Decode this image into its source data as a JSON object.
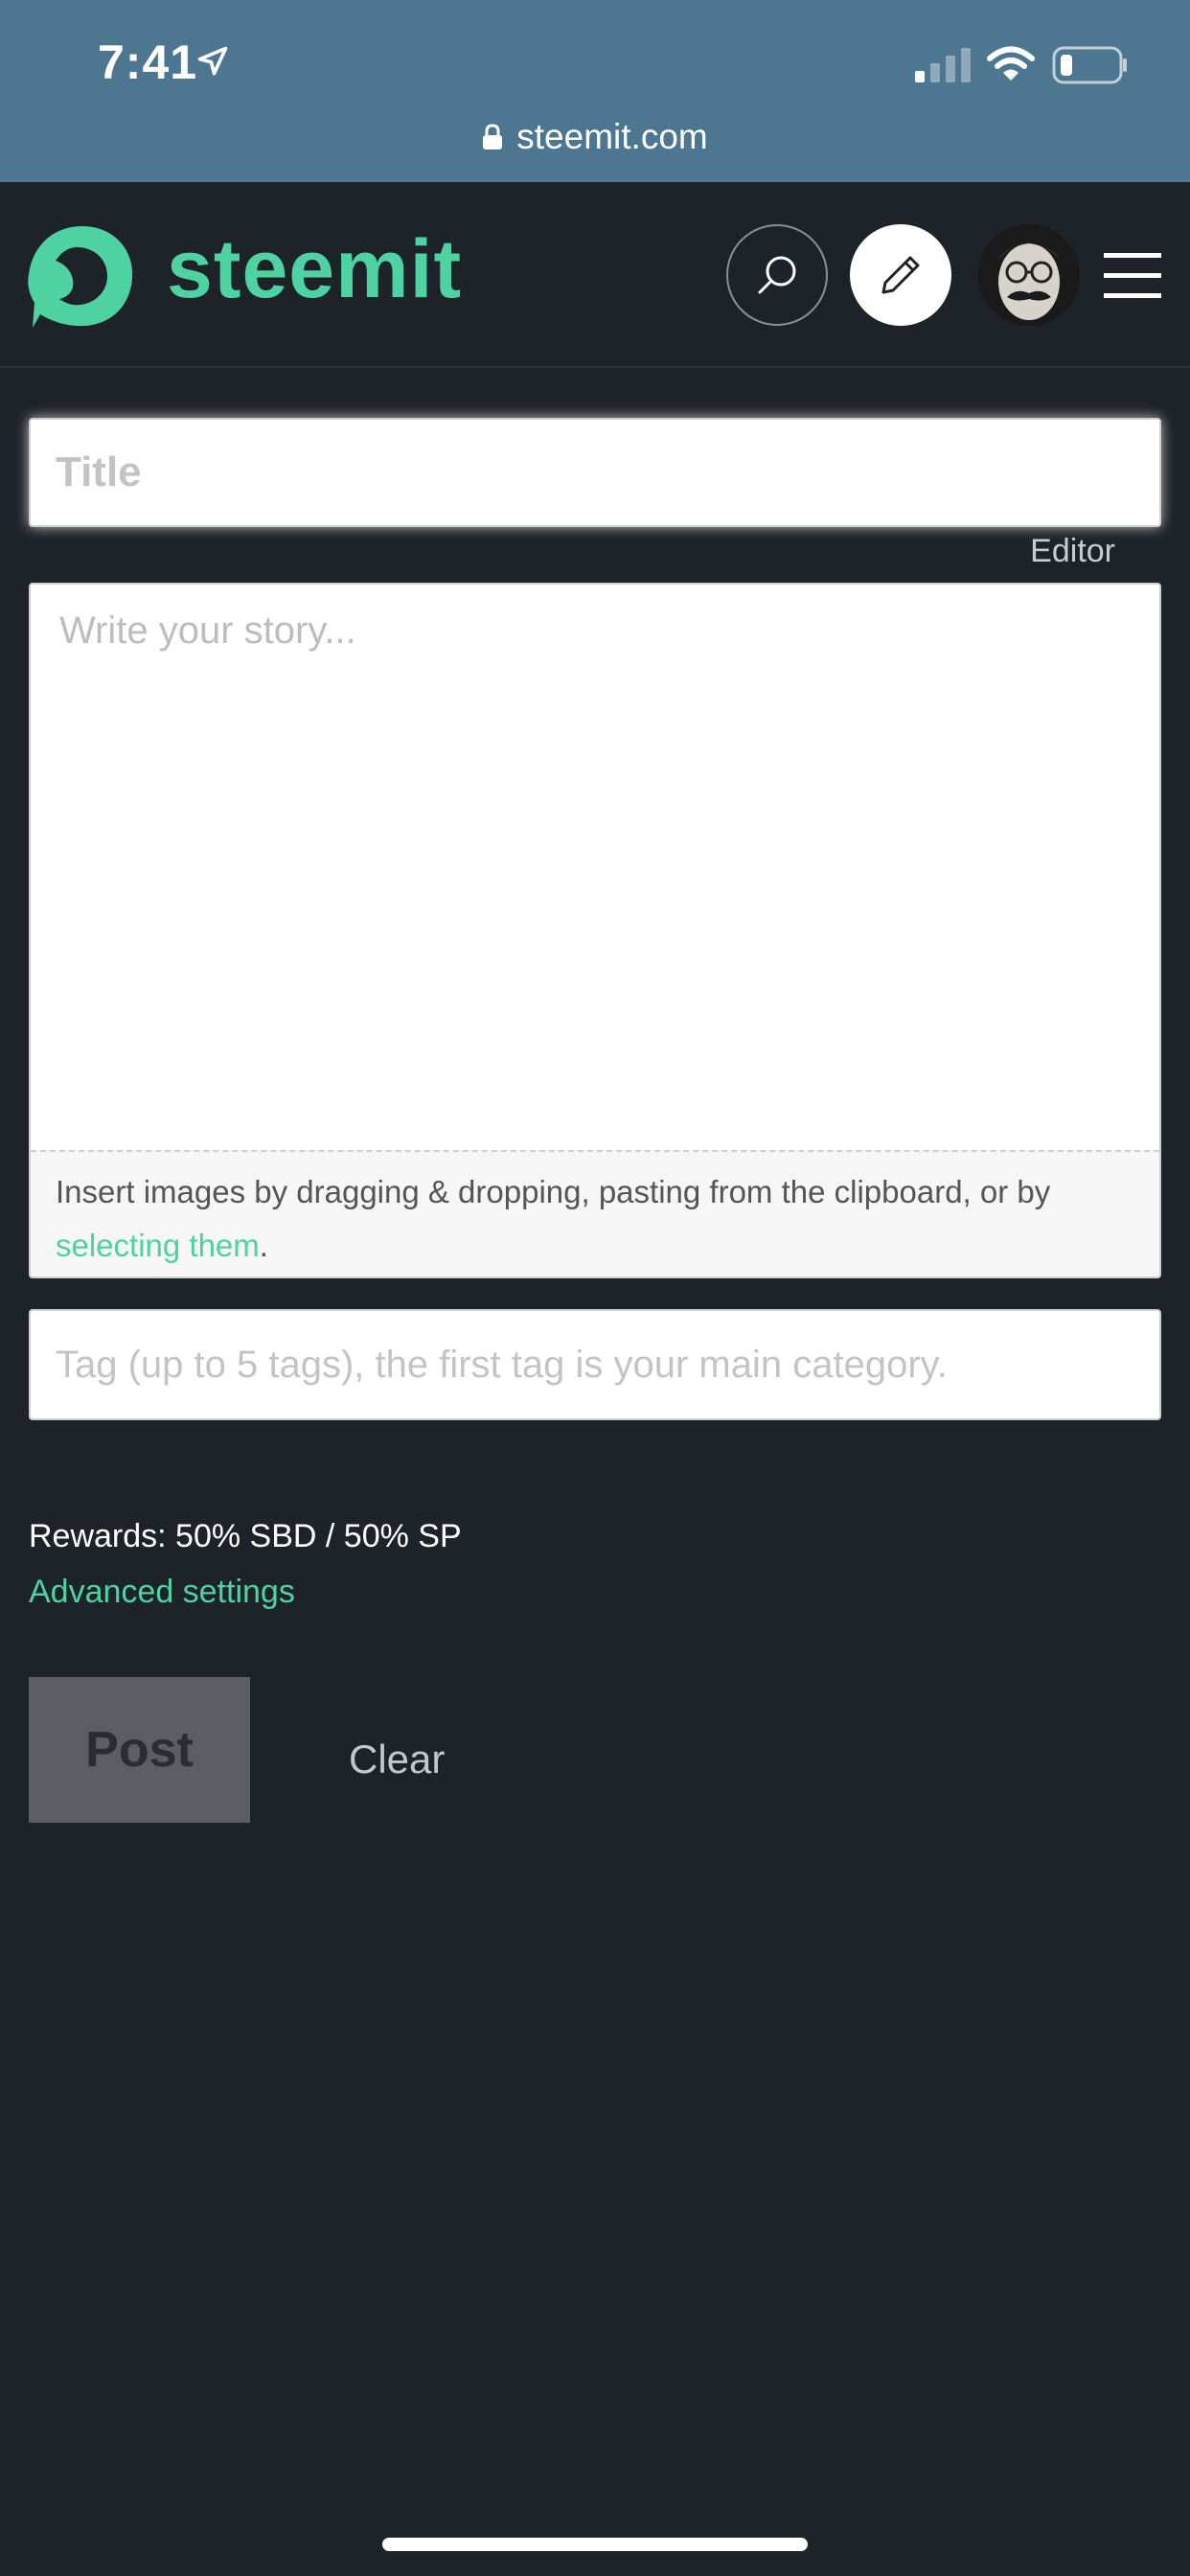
{
  "status_bar": {
    "time": "7:41",
    "url": "steemit.com"
  },
  "header": {
    "logo_text": "steemit",
    "brand_color": "#4ed2a1",
    "icons": [
      "steemit-logo-icon",
      "search-icon",
      "pencil-icon",
      "avatar",
      "hamburger-menu-icon"
    ]
  },
  "form": {
    "title_placeholder": "Title",
    "editor_toggle": "Editor",
    "story_placeholder": "Write your story...",
    "dropzone_text": "Insert images by dragging & dropping, pasting from the clipboard, or by ",
    "dropzone_link": "selecting them",
    "dropzone_suffix": ".",
    "tags_placeholder": "Tag (up to 5 tags), the first tag is your main category.",
    "rewards": "Rewards: 50% SBD / 50% SP",
    "advanced_settings": "Advanced settings",
    "post_label": "Post",
    "clear_label": "Clear"
  }
}
